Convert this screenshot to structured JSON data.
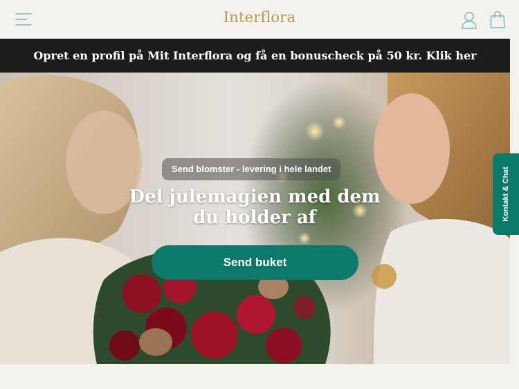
{
  "header": {
    "logo_text": "Interflora",
    "menu_icon": "hamburger-menu-icon",
    "account_icon": "user-icon",
    "bag_icon": "shopping-bag-icon",
    "accent_color": "#8cc2bd",
    "logo_color": "#b39a4c"
  },
  "promo_banner": {
    "text": "Opret en profil på Mit Interflora og få en bonuscheck på 50 kr. Klik her"
  },
  "hero": {
    "tagline": "Send blomster - levering i hele landet",
    "headline_line1": "Del julemagien med dem",
    "headline_line2": "du holder af",
    "cta_label": "Send buket"
  },
  "chat_tab": {
    "label": "Kontakt & Chat"
  },
  "colors": {
    "brand_green": "#0b7a6a",
    "promo_bg": "#1d1d1d",
    "page_bg": "#f3f2ef"
  }
}
